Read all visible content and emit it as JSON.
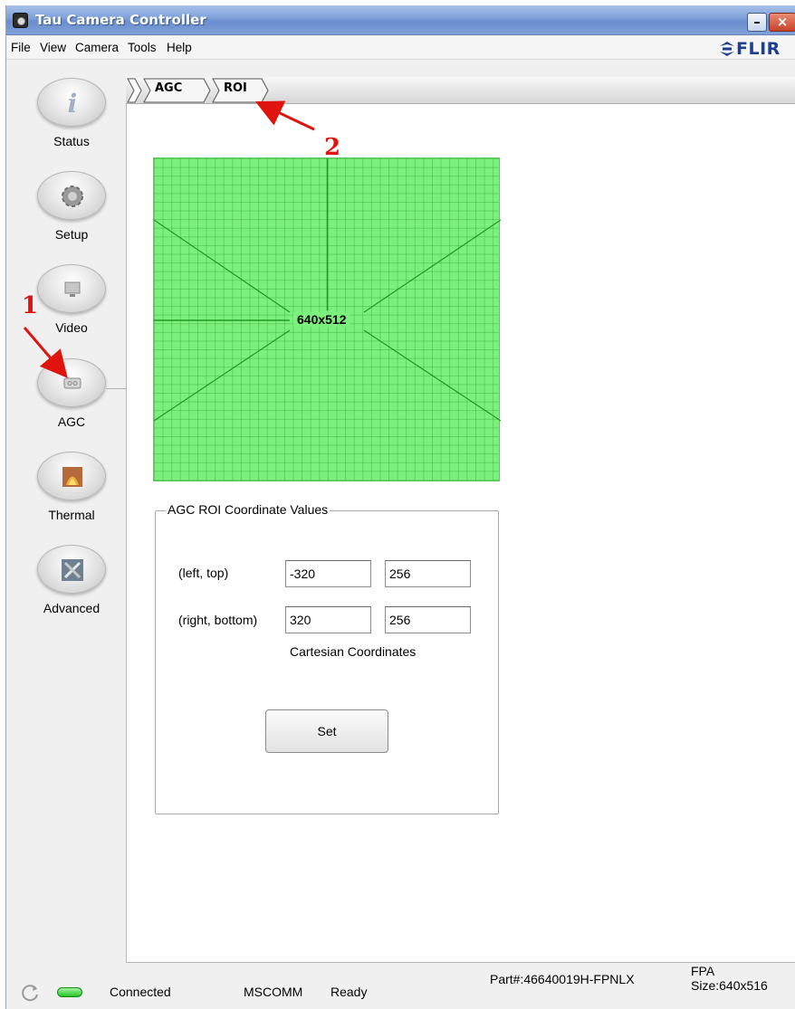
{
  "window": {
    "title": "Tau Camera Controller",
    "minimize_glyph": "–",
    "close_glyph": "×"
  },
  "menu": {
    "items": [
      "File",
      "View",
      "Camera",
      "Tools",
      "Help"
    ],
    "brand": "FLIR"
  },
  "sidebar": {
    "items": [
      {
        "label": "Status",
        "icon": "info-icon"
      },
      {
        "label": "Setup",
        "icon": "gear-icon"
      },
      {
        "label": "Video",
        "icon": "monitor-icon"
      },
      {
        "label": "AGC",
        "icon": "agc-icon"
      },
      {
        "label": "Thermal",
        "icon": "thermal-icon"
      },
      {
        "label": "Advanced",
        "icon": "tools-icon"
      }
    ],
    "selected": "AGC"
  },
  "breadcrumb": {
    "items": [
      "AGC",
      "ROI"
    ]
  },
  "sensor": {
    "label": "640x512"
  },
  "roi": {
    "group_title": "AGC ROI Coordinate Values",
    "left_top_label": "(left, top)",
    "right_bottom_label": "(right, bottom)",
    "left": "-320",
    "top": "256",
    "right": "320",
    "bottom": "256",
    "note": "Cartesian Coordinates",
    "set_label": "Set"
  },
  "status": {
    "connection": "Connected",
    "port": "MSCOMM",
    "state": "Ready",
    "part": "Part#:46640019H-FPNLX",
    "fpa_label": "FPA",
    "fpa_size": "Size:640x516"
  },
  "annotations": {
    "one": "1",
    "two": "2",
    "color": "#e0140f"
  },
  "colors": {
    "sensor_fill": "#7cf07c",
    "sensor_lines": "#1f9a1f",
    "title_bar": "#7c9fd9",
    "status_led": "#25c425"
  }
}
